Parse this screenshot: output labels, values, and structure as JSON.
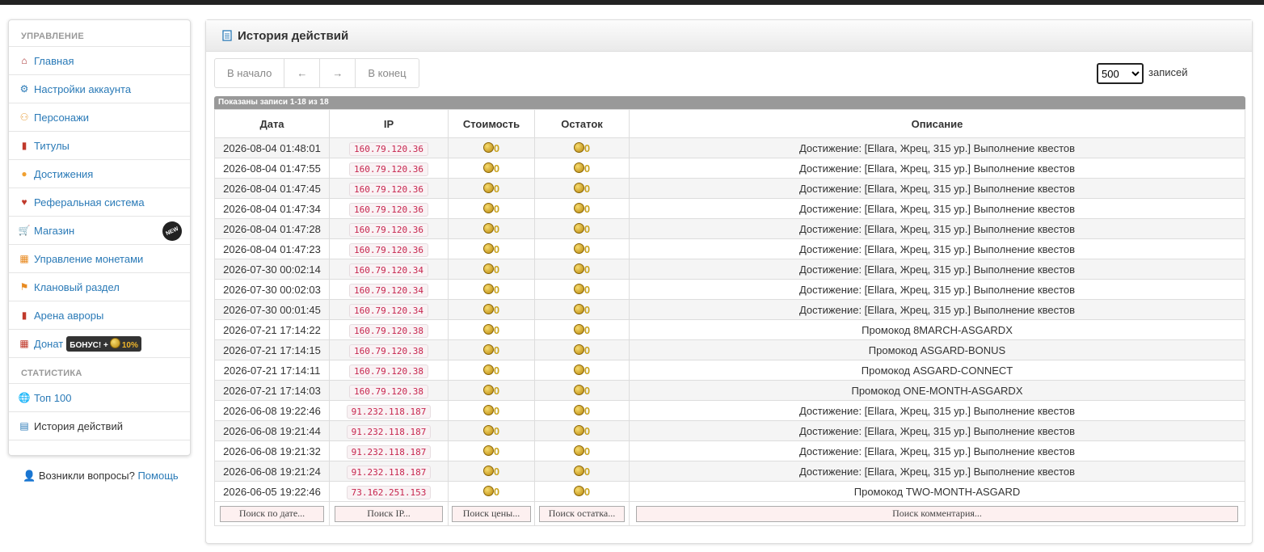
{
  "sidebar": {
    "section_management": "Управление",
    "section_stats": "Статистика",
    "items": [
      {
        "label": "Главная",
        "icon": "home-icon",
        "color": "#a33"
      },
      {
        "label": "Настройки аккаунта",
        "icon": "gear-icon",
        "color": "#2a7ab7"
      },
      {
        "label": "Персонажи",
        "icon": "users-icon",
        "color": "#e8a040"
      },
      {
        "label": "Титулы",
        "icon": "bookmark-icon",
        "color": "#c0392b"
      },
      {
        "label": "Достижения",
        "icon": "lightbulb-icon",
        "color": "#f0a030"
      },
      {
        "label": "Реферальная система",
        "icon": "heart-icon",
        "color": "#c0392b"
      },
      {
        "label": "Магазин",
        "icon": "cart-icon",
        "color": "#3a9a3a",
        "badge": "NEW"
      },
      {
        "label": "Управление монетами",
        "icon": "coins-icon",
        "color": "#e88a20"
      },
      {
        "label": "Клановый раздел",
        "icon": "flag-icon",
        "color": "#e88a20"
      },
      {
        "label": "Арена авроры",
        "icon": "bookmark-icon",
        "color": "#c0392b"
      },
      {
        "label": "Донат",
        "icon": "basket-icon",
        "color": "#c0392b",
        "bonus_label": "БОНУС! +",
        "bonus_pct": "10%"
      }
    ],
    "stats_items": [
      {
        "label": "Топ 100",
        "icon": "globe-icon",
        "color": "#2a7ab7"
      },
      {
        "label": "История действий",
        "icon": "document-icon",
        "color": "#2a7ab7",
        "active": true
      }
    ]
  },
  "help": {
    "text": "Возникли вопросы?",
    "link": "Помощь"
  },
  "panel": {
    "title": "История действий",
    "pager": {
      "first": "В начало",
      "prev": "←",
      "next": "→",
      "last": "В конец"
    },
    "per_page": {
      "value": "500",
      "label": "записей"
    },
    "info": "Показаны записи 1-18 из 18",
    "columns": [
      "Дата",
      "IP",
      "Стоимость",
      "Остаток",
      "Описание"
    ],
    "rows": [
      {
        "date": "2026-08-04 01:48:01",
        "ip": "160.79.120.36",
        "cost": "0",
        "rest": "0",
        "desc": "Достижение: [Ellara, Жрец, 315 ур.] Выполнение квестов"
      },
      {
        "date": "2026-08-04 01:47:55",
        "ip": "160.79.120.36",
        "cost": "0",
        "rest": "0",
        "desc": "Достижение: [Ellara, Жрец, 315 ур.] Выполнение квестов"
      },
      {
        "date": "2026-08-04 01:47:45",
        "ip": "160.79.120.36",
        "cost": "0",
        "rest": "0",
        "desc": "Достижение: [Ellara, Жрец, 315 ур.] Выполнение квестов"
      },
      {
        "date": "2026-08-04 01:47:34",
        "ip": "160.79.120.36",
        "cost": "0",
        "rest": "0",
        "desc": "Достижение: [Ellara, Жрец, 315 ур.] Выполнение квестов"
      },
      {
        "date": "2026-08-04 01:47:28",
        "ip": "160.79.120.36",
        "cost": "0",
        "rest": "0",
        "desc": "Достижение: [Ellara, Жрец, 315 ур.] Выполнение квестов"
      },
      {
        "date": "2026-08-04 01:47:23",
        "ip": "160.79.120.36",
        "cost": "0",
        "rest": "0",
        "desc": "Достижение: [Ellara, Жрец, 315 ур.] Выполнение квестов"
      },
      {
        "date": "2026-07-30 00:02:14",
        "ip": "160.79.120.34",
        "cost": "0",
        "rest": "0",
        "desc": "Достижение: [Ellara, Жрец, 315 ур.] Выполнение квестов"
      },
      {
        "date": "2026-07-30 00:02:03",
        "ip": "160.79.120.34",
        "cost": "0",
        "rest": "0",
        "desc": "Достижение: [Ellara, Жрец, 315 ур.] Выполнение квестов"
      },
      {
        "date": "2026-07-30 00:01:45",
        "ip": "160.79.120.34",
        "cost": "0",
        "rest": "0",
        "desc": "Достижение: [Ellara, Жрец, 315 ур.] Выполнение квестов"
      },
      {
        "date": "2026-07-21 17:14:22",
        "ip": "160.79.120.38",
        "cost": "0",
        "rest": "0",
        "desc": "Промокод 8MARCH-ASGARDX"
      },
      {
        "date": "2026-07-21 17:14:15",
        "ip": "160.79.120.38",
        "cost": "0",
        "rest": "0",
        "desc": "Промокод ASGARD-BONUS"
      },
      {
        "date": "2026-07-21 17:14:11",
        "ip": "160.79.120.38",
        "cost": "0",
        "rest": "0",
        "desc": "Промокод ASGARD-CONNECT"
      },
      {
        "date": "2026-07-21 17:14:03",
        "ip": "160.79.120.38",
        "cost": "0",
        "rest": "0",
        "desc": "Промокод ONE-MONTH-ASGARDX"
      },
      {
        "date": "2026-06-08 19:22:46",
        "ip": "91.232.118.187",
        "cost": "0",
        "rest": "0",
        "desc": "Достижение: [Ellara, Жрец, 315 ур.] Выполнение квестов"
      },
      {
        "date": "2026-06-08 19:21:44",
        "ip": "91.232.118.187",
        "cost": "0",
        "rest": "0",
        "desc": "Достижение: [Ellara, Жрец, 315 ур.] Выполнение квестов"
      },
      {
        "date": "2026-06-08 19:21:32",
        "ip": "91.232.118.187",
        "cost": "0",
        "rest": "0",
        "desc": "Достижение: [Ellara, Жрец, 315 ур.] Выполнение квестов"
      },
      {
        "date": "2026-06-08 19:21:24",
        "ip": "91.232.118.187",
        "cost": "0",
        "rest": "0",
        "desc": "Достижение: [Ellara, Жрец, 315 ур.] Выполнение квестов"
      },
      {
        "date": "2026-06-05 19:22:46",
        "ip": "73.162.251.153",
        "cost": "0",
        "rest": "0",
        "desc": "Промокод TWO-MONTH-ASGARD"
      }
    ],
    "filters": [
      "Поиск по дате...",
      "Поиск IP...",
      "Поиск цены...",
      "Поиск остатка...",
      "Поиск комментария..."
    ]
  }
}
